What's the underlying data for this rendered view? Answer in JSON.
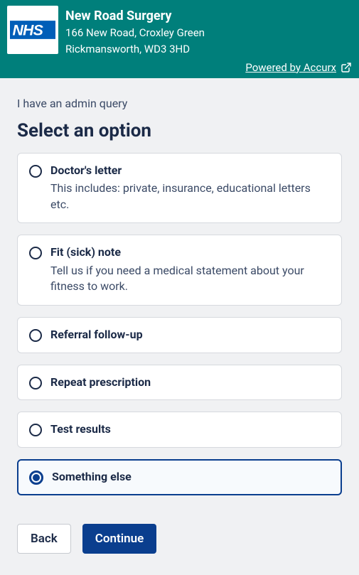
{
  "header": {
    "logo_text": "NHS",
    "surgery_name": "New Road Surgery",
    "address_line1": "166 New Road, Croxley Green",
    "address_line2": "Rickmansworth, WD3 3HD",
    "powered_label": "Powered by Accurx"
  },
  "breadcrumb": "I have an admin query",
  "page_title": "Select an option",
  "options": [
    {
      "id": "doctors-letter",
      "title": "Doctor's letter",
      "desc": "This includes: private, insurance, educational letters etc.",
      "selected": false
    },
    {
      "id": "fit-note",
      "title": "Fit (sick) note",
      "desc": "Tell us if you need a medical statement about your fitness to work.",
      "selected": false
    },
    {
      "id": "referral-follow-up",
      "title": "Referral follow-up",
      "desc": "",
      "selected": false
    },
    {
      "id": "repeat-prescription",
      "title": "Repeat prescription",
      "desc": "",
      "selected": false
    },
    {
      "id": "test-results",
      "title": "Test results",
      "desc": "",
      "selected": false
    },
    {
      "id": "something-else",
      "title": "Something else",
      "desc": "",
      "selected": true
    }
  ],
  "buttons": {
    "back": "Back",
    "continue": "Continue"
  }
}
